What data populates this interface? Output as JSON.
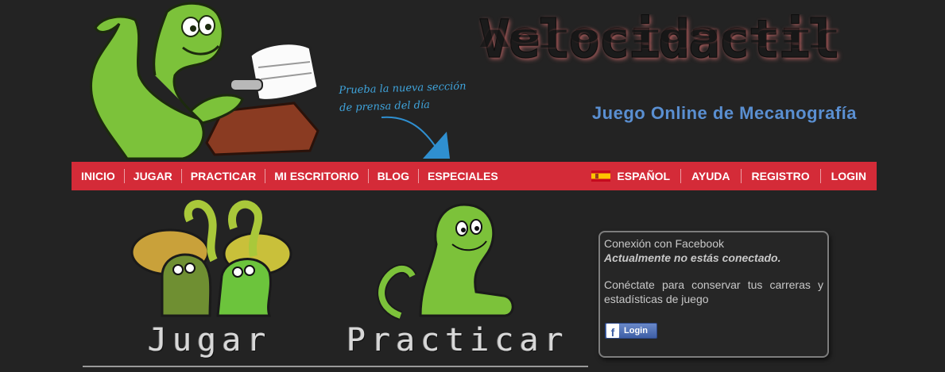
{
  "header": {
    "site_title": "Velocidactil",
    "subtitle": "Juego Online de Mecanografía",
    "promo_line1": "Prueba la nueva sección",
    "promo_line2": "de prensa del día"
  },
  "nav": {
    "left": [
      "INICIO",
      "JUGAR",
      "PRACTICAR",
      "MI ESCRITORIO",
      "BLOG",
      "ESPECIALES"
    ],
    "language": "ESPAÑOL",
    "right": [
      "AYUDA",
      "REGISTRO",
      "LOGIN"
    ],
    "accent_color": "#d42b38"
  },
  "tiles": {
    "jugar_label": "Jugar",
    "practicar_label": "Practicar"
  },
  "facebook": {
    "title": "Conexión con Facebook",
    "status": "Actualmente no estás conectado.",
    "message": "Conéctate para conservar tus carreras y estadísticas de juego",
    "button_label": "Login",
    "button_icon": "facebook-f-icon"
  }
}
